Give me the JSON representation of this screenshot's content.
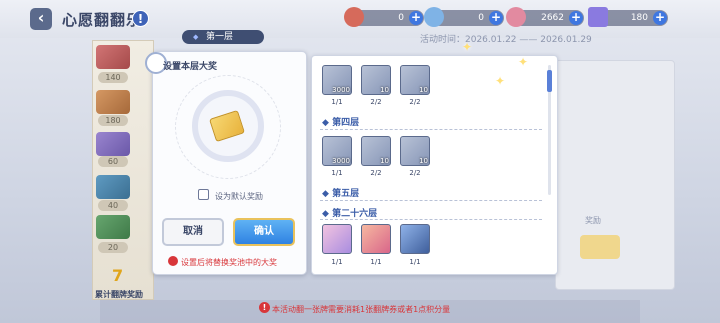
{
  "header": {
    "back_glyph": "‹",
    "title": "心愿翻翻乐",
    "help_glyph": "!"
  },
  "resources": [
    {
      "name": "resource-1",
      "value": "0",
      "plus": "+",
      "color": "#d66a5b"
    },
    {
      "name": "resource-2",
      "value": "0",
      "plus": "+",
      "color": "#7fb3e6"
    },
    {
      "name": "resource-3",
      "value": "2662",
      "plus": "+",
      "color": "#e28aa0"
    },
    {
      "name": "resource-4",
      "value": "180",
      "plus": "+",
      "color": "#8a7ae0"
    }
  ],
  "floor_tab": "第一层",
  "activity_time": "活动时间：2026.01.22 —— 2026.01.29",
  "side": {
    "counts": [
      "140",
      "180",
      "60",
      "40",
      "20"
    ],
    "cumulative_value": "7",
    "cumulative_label": "累计翻牌奖励"
  },
  "modal": {
    "title": "设置本层大奖",
    "default_label": "设为默认奖励",
    "cancel": "取消",
    "confirm": "确认",
    "warning": "设置后将替换奖池中的大奖"
  },
  "sections": [
    {
      "label": "",
      "items": [
        {
          "q": "3000",
          "c": "1/1"
        },
        {
          "q": "10",
          "c": "2/2"
        },
        {
          "q": "10",
          "c": "2/2"
        }
      ]
    },
    {
      "label": "第四层",
      "items": [
        {
          "q": "3000",
          "c": "1/1"
        },
        {
          "q": "10",
          "c": "2/2"
        },
        {
          "q": "10",
          "c": "2/2"
        }
      ]
    },
    {
      "label": "第五层",
      "items": []
    },
    {
      "label": "第二十六层",
      "items": [
        {
          "q": "",
          "c": "1/1"
        },
        {
          "q": "",
          "c": "1/1"
        },
        {
          "q": "",
          "c": "1/1"
        }
      ]
    }
  ],
  "right": {
    "label": "奖励"
  },
  "bottom": {
    "warning": "本活动翻一张牌需要消耗1张翻牌券或者1点积分量"
  }
}
